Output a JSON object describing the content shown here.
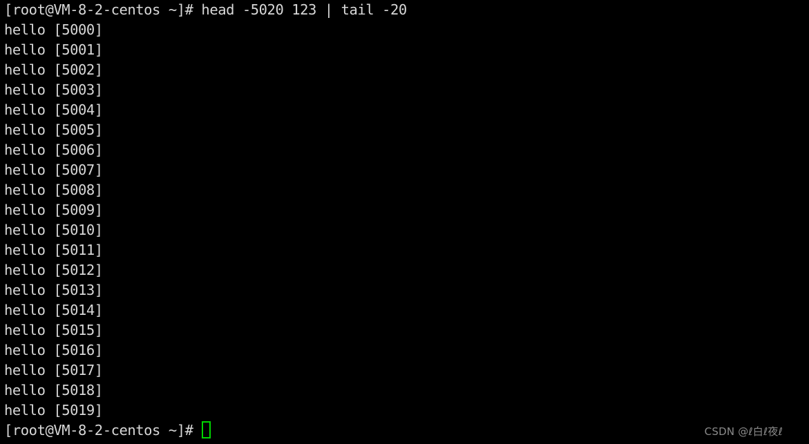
{
  "terminal": {
    "background_color": "#000000",
    "foreground_color": "#d8d8d8",
    "cursor_color": "#00d700",
    "prompt": "[root@VM-8-2-centos ~]#",
    "command_line": {
      "prompt": "[root@VM-8-2-centos ~]# ",
      "command": "head -5020 123 | tail -20"
    },
    "output_lines": [
      "hello [5000]",
      "hello [5001]",
      "hello [5002]",
      "hello [5003]",
      "hello [5004]",
      "hello [5005]",
      "hello [5006]",
      "hello [5007]",
      "hello [5008]",
      "hello [5009]",
      "hello [5010]",
      "hello [5011]",
      "hello [5012]",
      "hello [5013]",
      "hello [5014]",
      "hello [5015]",
      "hello [5016]",
      "hello [5017]",
      "hello [5018]",
      "hello [5019]"
    ],
    "final_prompt": "[root@VM-8-2-centos ~]# ",
    "cursor": "block-outline-cursor"
  },
  "watermark": {
    "text": "CSDN @ℓ白ℓ夜ℓ",
    "color": "#8a8a8a"
  }
}
